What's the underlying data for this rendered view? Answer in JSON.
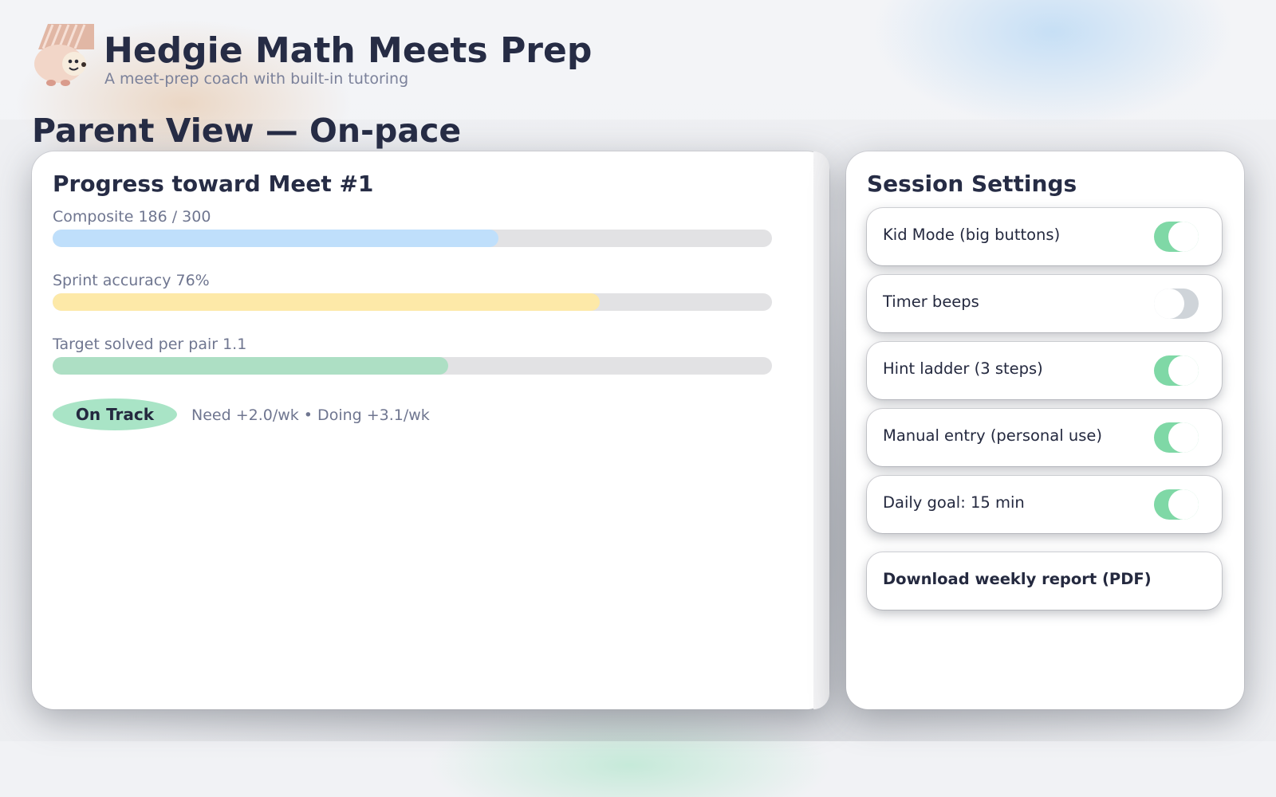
{
  "app": {
    "title": "Hedgie Math Meets Prep",
    "subtitle": "A meet-prep coach with built-in tutoring",
    "logo_icon": "hedgehog-mascot-icon"
  },
  "view": {
    "title": "Parent View — On-pace"
  },
  "progress": {
    "heading": "Progress toward Meet #1",
    "metrics": [
      {
        "label": "Composite 186 / 300",
        "fraction": 0.62,
        "color": "#bfdffb"
      },
      {
        "label": "Sprint accuracy 76%",
        "fraction": 0.76,
        "color": "#fde9a8"
      },
      {
        "label": "Target solved per pair 1.1",
        "fraction": 0.55,
        "color": "#addfc4"
      }
    ],
    "status": {
      "label": "On Track",
      "pace_text": "Need +2.0/wk • Doing +3.1/wk",
      "color": "#a9e4c6"
    }
  },
  "settings": {
    "heading": "Session Settings",
    "items": [
      {
        "label": "Kid Mode (big buttons)",
        "enabled": true
      },
      {
        "label": "Timer beeps",
        "enabled": false
      },
      {
        "label": "Hint ladder (3 steps)",
        "enabled": true
      },
      {
        "label": "Manual entry (personal use)",
        "enabled": true
      },
      {
        "label": "Daily goal: 15 min",
        "enabled": true
      }
    ],
    "download_label": "Download weekly report (PDF)",
    "toggle_on_color": "#7fd8a6",
    "toggle_off_color": "#cfd4d9"
  }
}
